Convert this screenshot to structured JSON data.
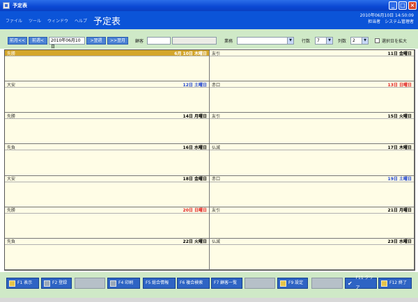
{
  "window": {
    "title": "予定表"
  },
  "menu": [
    "ファイル",
    "ツール",
    "ウィンドウ",
    "ヘルプ"
  ],
  "app_title": "予定表",
  "header_info": {
    "datetime": "2010年06月10日 14:50:09",
    "user": "担当者　システム管理者"
  },
  "toolbar": {
    "prev_month": "前月<<",
    "prev_week": "前週<",
    "date": "2010年06月10日",
    "next_week": ">翌週",
    "next_month": ">>翌月",
    "customer_label": "顧客",
    "business_label": "業務",
    "rows_label": "行数",
    "rows_value": "7",
    "cols_label": "列数",
    "cols_value": "2",
    "enlarge_label": "選択日を拡大"
  },
  "calendar": [
    {
      "rokuyo": "先勝",
      "date": "6月 10日 木曜日",
      "style": "sel"
    },
    {
      "rokuyo": "友引",
      "date": "11日 金曜日",
      "style": ""
    },
    {
      "rokuyo": "大安",
      "date": "12日 土曜日",
      "style": "blue"
    },
    {
      "rokuyo": "赤口",
      "date": "13日 日曜日",
      "style": "red"
    },
    {
      "rokuyo": "先勝",
      "date": "14日 月曜日",
      "style": ""
    },
    {
      "rokuyo": "友引",
      "date": "15日 火曜日",
      "style": ""
    },
    {
      "rokuyo": "先負",
      "date": "16日 水曜日",
      "style": ""
    },
    {
      "rokuyo": "仏滅",
      "date": "17日 木曜日",
      "style": ""
    },
    {
      "rokuyo": "大安",
      "date": "18日 金曜日",
      "style": ""
    },
    {
      "rokuyo": "赤口",
      "date": "19日 土曜日",
      "style": "blue"
    },
    {
      "rokuyo": "先勝",
      "date": "20日 日曜日",
      "style": "red"
    },
    {
      "rokuyo": "友引",
      "date": "21日 月曜日",
      "style": ""
    },
    {
      "rokuyo": "先負",
      "date": "22日 火曜日",
      "style": ""
    },
    {
      "rokuyo": "仏滅",
      "date": "23日 水曜日",
      "style": ""
    }
  ],
  "fkeys": {
    "f1": "F1 表示",
    "f2": "F2 登録",
    "f4": "F4 印刷",
    "f5": "F5 総合情報",
    "f6": "F6 複合検索",
    "f7": "F7 顧客一覧",
    "f9": "F9 設定",
    "f11": "F11 クリア",
    "f12": "F12 終了"
  }
}
